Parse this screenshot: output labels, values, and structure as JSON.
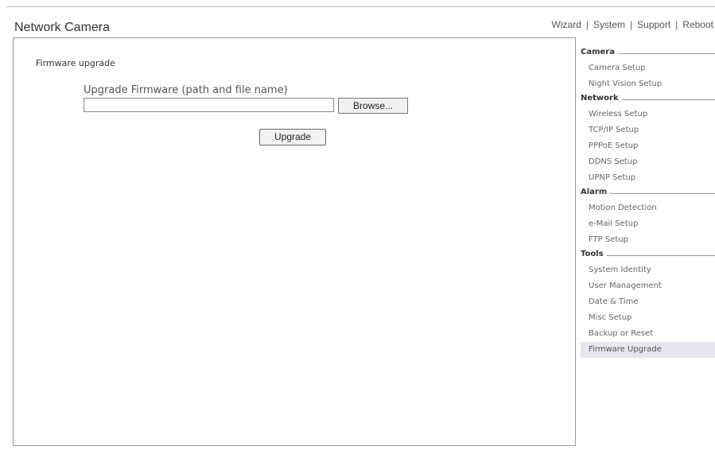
{
  "header": {
    "title": "Network Camera",
    "nav": [
      {
        "label": "Wizard"
      },
      {
        "label": "System"
      },
      {
        "label": "Support"
      },
      {
        "label": "Reboot"
      }
    ]
  },
  "main": {
    "section_title": "Firmware upgrade",
    "field_label": "Upgrade Firmware (path and file name)",
    "file_input_value": "",
    "browse_label": "Browse...",
    "upgrade_label": "Upgrade"
  },
  "sidebar": {
    "categories": [
      {
        "label": "Camera",
        "items": [
          "Camera Setup",
          "Night Vision Setup"
        ]
      },
      {
        "label": "Network",
        "items": [
          "Wireless Setup",
          "TCP/IP Setup",
          "PPPoE Setup",
          "DDNS Setup",
          "UPNP Setup"
        ]
      },
      {
        "label": "Alarm",
        "items": [
          "Motion Detection",
          "e-Mail Setup",
          "FTP Setup"
        ]
      },
      {
        "label": "Tools",
        "items": [
          "System Identity",
          "User Management",
          "Date & Time",
          "Misc Setup",
          "Backup or Reset",
          "Firmware Upgrade"
        ]
      }
    ],
    "active_item": "Firmware Upgrade"
  }
}
